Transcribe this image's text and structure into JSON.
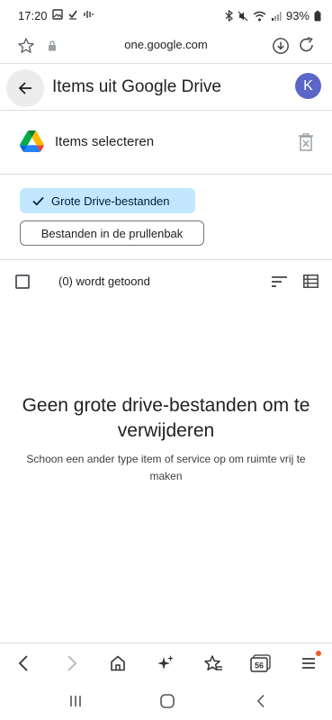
{
  "status_bar": {
    "time": "17:20",
    "battery": "93%",
    "left_icons": [
      "image-icon",
      "check-icon",
      "voicemail-icon"
    ],
    "right_icons": [
      "bluetooth-icon",
      "mute-icon",
      "wifi-icon",
      "signal-icon",
      "battery-icon"
    ]
  },
  "browser": {
    "url": "one.google.com"
  },
  "header": {
    "title": "Items uit Google Drive",
    "avatar_letter": "K",
    "avatar_color": "#5b67c8"
  },
  "select_section": {
    "label": "Items selecteren"
  },
  "filters": {
    "active_chip": "Grote Drive-bestanden",
    "secondary_chip": "Bestanden in de prullenbak"
  },
  "list": {
    "count_label": "(0) wordt getoond"
  },
  "empty_state": {
    "title": "Geen grote drive-bestanden om te verwijderen",
    "subtitle": "Schoon een ander type item of service op om ruimte vrij te maken"
  },
  "bottom_nav": {
    "tab_count": "56",
    "items": [
      "back-icon",
      "forward-icon",
      "home-icon",
      "sparkle-icon",
      "bookmark-star-icon",
      "tabs-icon",
      "menu-icon"
    ]
  },
  "colors": {
    "chip_active_bg": "#c2e7ff",
    "notification_dot": "#f05a28"
  }
}
